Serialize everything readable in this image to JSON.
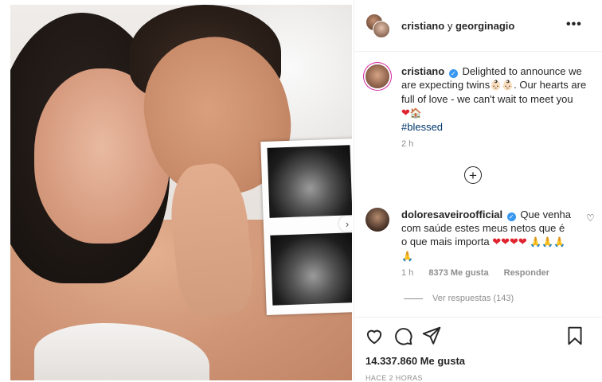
{
  "header": {
    "account_primary": "cristiano",
    "joiner": "y",
    "account_secondary": "georginagio",
    "more_icon": "more-horizontal-icon"
  },
  "caption": {
    "username": "cristiano",
    "verified_icon": "verified-badge-icon",
    "text_1": "Delighted to announce we are expecting twins",
    "emoji_babies": "👶🏻👶🏻",
    "text_2": ". Our hearts are full of love - we can't wait to meet you",
    "emoji_heart": "❤",
    "emoji_house": "🏠",
    "hashtag": "#blessed",
    "timestamp": "2 h"
  },
  "comment": {
    "username": "doloresaveiroofficial",
    "verified_icon": "verified-badge-icon",
    "text": "Que venha com saúde estes meus netos que é o que mais importa",
    "emoji_hearts": "❤❤❤❤",
    "emoji_pray": "🙏🙏🙏🙏",
    "time": "1 h",
    "likes": "8373 Me gusta",
    "reply_label": "Responder",
    "view_replies": "Ver respuestas (143)"
  },
  "actions": {
    "like_icon": "heart-icon",
    "comment_icon": "comment-icon",
    "share_icon": "paper-plane-icon",
    "save_icon": "bookmark-icon",
    "likes_count": "14.337.860 Me gusta",
    "posted": "HACE 2 HORAS"
  },
  "colors": {
    "verified": "#3897f0",
    "heart": "#e0242f",
    "hashtag": "#00376b",
    "muted": "#8e8e8e"
  }
}
